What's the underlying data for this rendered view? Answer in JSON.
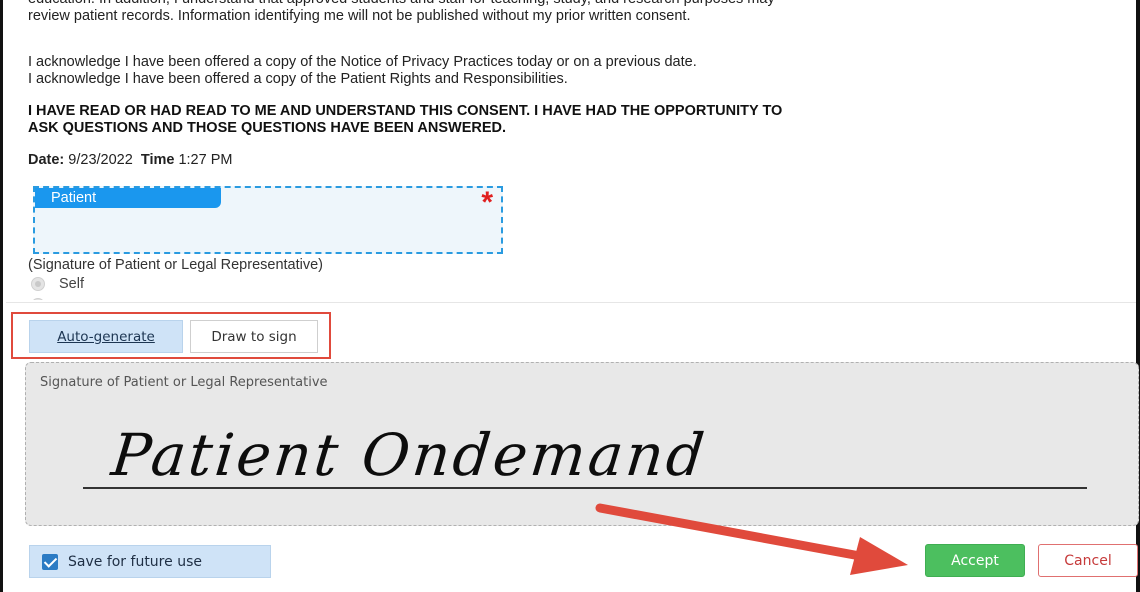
{
  "consent": {
    "para1_line1": "education. In addition, I understand that approved students and staff for teaching, study, and research purposes may",
    "para1_line2": "review patient records.  Information identifying me will not be published without my prior written consent.",
    "para2_line1": "I acknowledge I have been offered a copy of the Notice of Privacy Practices today or on a previous date.",
    "para2_line2": "I acknowledge I have been offered a copy of the Patient Rights and Responsibilities.",
    "para3_line1": "I HAVE READ OR HAD READ TO ME AND UNDERSTAND THIS CONSENT.  I HAVE HAD THE OPPORTUNITY TO",
    "para3_line2": "ASK QUESTIONS AND THOSE QUESTIONS HAVE BEEN ANSWERED."
  },
  "date_line": {
    "date_label": "Date:",
    "date_value": "9/23/2022",
    "time_label": "Time",
    "time_value": "1:27 PM"
  },
  "signature_field": {
    "tab_label": "Patient",
    "required_mark": "*",
    "caption": "(Signature of Patient or Legal Representative)",
    "radio_option": "Self"
  },
  "signature_panel": {
    "tabs": [
      "Auto-generate",
      "Draw to sign"
    ],
    "pad_label": "Signature of Patient or Legal Representative",
    "signature_text": "Patient Ondemand",
    "save_label": "Save for future use",
    "save_checked": true,
    "accept_label": "Accept",
    "cancel_label": "Cancel"
  },
  "colors": {
    "accent_blue": "#1a97ee",
    "highlight_red": "#e04a3c",
    "accept_green": "#4cbf5f",
    "cancel_red": "#c63a3a"
  }
}
